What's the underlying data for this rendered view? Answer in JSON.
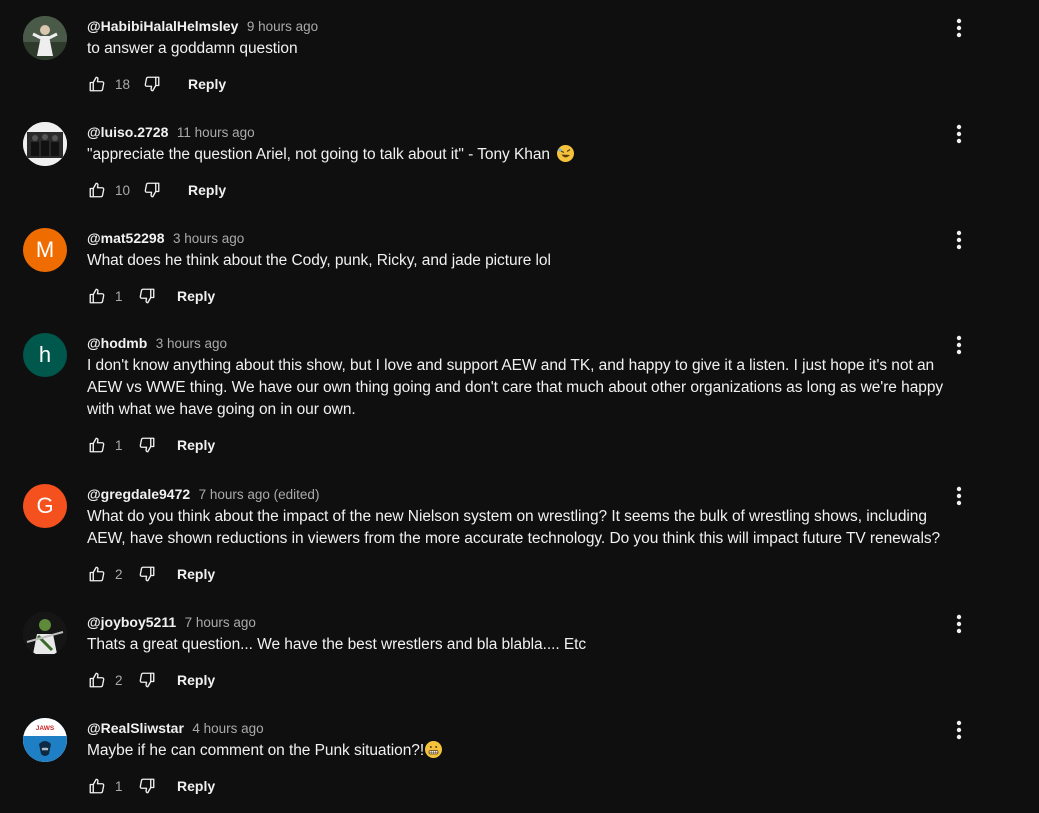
{
  "comments": [
    {
      "author": "@HabibiHalalHelmsley",
      "time": "9 hours ago",
      "text": "to answer a goddamn question",
      "likes": "18",
      "reply_label": "Reply",
      "avatar_type": "photo",
      "avatar_color": "#3a4a3a",
      "avatar_icon": "photo-avatar-icon"
    },
    {
      "author": "@luiso.2728",
      "time": "11 hours ago",
      "text": "\"appreciate the question Ariel, not going to talk about it\" - Tony Khan",
      "emoji": "rolling-on-floor-laughing-emoji",
      "likes": "10",
      "reply_label": "Reply",
      "avatar_type": "photo",
      "avatar_color": "#e8e8e8",
      "avatar_icon": "photo-avatar-icon"
    },
    {
      "author": "@mat52298",
      "time": "3 hours ago",
      "text": "What does he think about the Cody, punk, Ricky, and jade picture lol",
      "likes": "1",
      "reply_label": "Reply",
      "avatar_type": "letter",
      "avatar_letter": "M",
      "avatar_color": "#ef6c00"
    },
    {
      "author": "@hodmb",
      "time": "3 hours ago",
      "text": "I don't know anything about this show, but I love and support AEW and TK, and happy to give it a listen. I just hope it's not an AEW vs WWE thing. We have our own thing going and don't care that much about other organizations as long as we're happy with what we have going on in our own.",
      "likes": "1",
      "reply_label": "Reply",
      "avatar_type": "letter",
      "avatar_letter": "h",
      "avatar_color": "#00574b"
    },
    {
      "author": "@gregdale9472",
      "time": "7 hours ago (edited)",
      "text": "What do you think about the impact of the new Nielson system on wrestling? It seems the bulk of wrestling shows, including AEW, have shown reductions in viewers from the more accurate technology. Do you think this will impact future TV renewals?",
      "likes": "2",
      "reply_label": "Reply",
      "avatar_type": "letter",
      "avatar_letter": "G",
      "avatar_color": "#f4511e"
    },
    {
      "author": "@joyboy5211",
      "time": "7 hours ago",
      "text": "Thats a great question... We have the best wrestlers and bla blabla.... Etc",
      "likes": "2",
      "reply_label": "Reply",
      "avatar_type": "photo",
      "avatar_color": "#1e1e1e",
      "avatar_icon": "photo-avatar-icon"
    },
    {
      "author": "@RealSliwstar",
      "time": "4 hours ago",
      "text": "Maybe if he can comment on the Punk situation?!",
      "emoji": "grimacing-emoji",
      "likes": "1",
      "reply_label": "Reply",
      "avatar_type": "photo",
      "avatar_color": "#2f8fd0",
      "avatar_text": "JAWS",
      "avatar_icon": "jaws-poster-avatar-icon"
    }
  ],
  "icons": {
    "like": "thumb-up-icon",
    "dislike": "thumb-down-icon",
    "more": "more-vertical-icon"
  }
}
